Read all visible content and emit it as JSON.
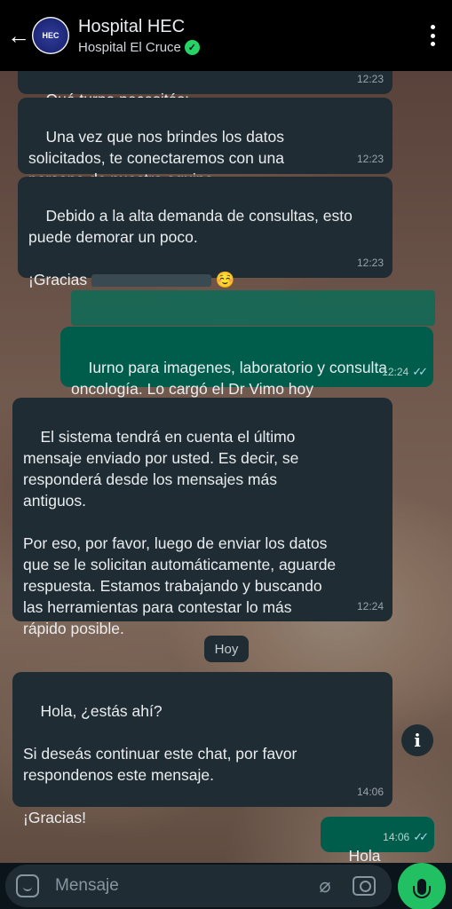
{
  "header": {
    "title": "Hospital HEC",
    "subtitle": "Hospital El Cruce",
    "avatar_text": "HEC",
    "verified_glyph": "✓"
  },
  "messages": [
    {
      "text": "Qué turno necesitás:",
      "time": "12:23",
      "direction": "in"
    },
    {
      "text": "Una vez que nos brindes los datos\nsolicitados, te conectaremos con una\npersona de nuestro equipo.",
      "time": "12:23",
      "direction": "in"
    },
    {
      "text": "Debido a la alta demanda de consultas, esto\npuede demorar un poco.\n\n¡Gracias ",
      "text_after": " ☺️",
      "time": "12:23",
      "direction": "in"
    },
    {
      "text": "Iurno para imagenes, laboratorio y consulta\noncología. Lo cargó el Dr Vimo hoy",
      "time": "12:24",
      "direction": "out"
    },
    {
      "text": "El sistema tendrá en cuenta el último\nmensaje enviado por usted. Es decir, se\nresponderá desde los mensajes más\nantiguos.\n\nPor eso, por favor, luego de enviar los datos\nque se le solicitan automáticamente, aguarde\nrespuesta. Estamos trabajando y buscando\nlas herramientas para contestar lo más\nrápido posible.",
      "time": "12:24",
      "direction": "in"
    },
    {
      "text": "Hola, ¿estás ahí?\n\nSi deseás continuar este chat, por favor\nrespondenos este mensaje.\n\n¡Gracias!",
      "time": "14:06",
      "direction": "in"
    },
    {
      "text": "Hola",
      "time": "14:06",
      "direction": "out"
    }
  ],
  "day_chip": "Hoy",
  "info_glyph": "i",
  "input": {
    "placeholder": "Mensaje"
  },
  "colors": {
    "incoming": "#1f2c33",
    "outgoing": "#005c4b",
    "accent": "#21c063"
  }
}
